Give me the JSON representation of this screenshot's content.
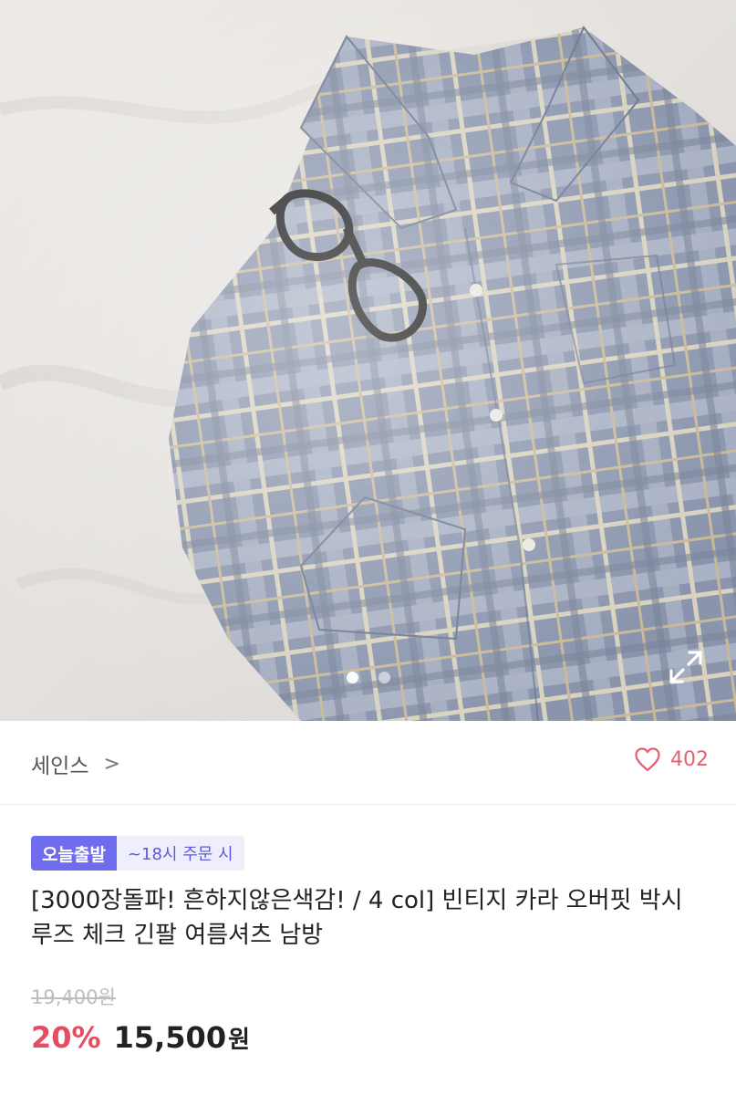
{
  "product_image": {
    "description_icon": "photo-plaid-shirt",
    "carousel_count": 2,
    "carousel_active": 1,
    "expand_icon": "expand-icon"
  },
  "seller": {
    "name": "세인스",
    "chevron": ">"
  },
  "likes": {
    "icon": "heart-icon",
    "count": "402"
  },
  "badges": {
    "main": "오늘출발",
    "sub": "~18시 주문 시"
  },
  "product": {
    "title": "[3000장돌파! 흔하지않은색감! / 4 col] 빈티지 카라 오버핏 박시 루즈 체크 긴팔 여름셔츠 남방",
    "original_price": "19,400원",
    "discount": "20%",
    "price": "15,500",
    "currency": "원"
  },
  "colors": {
    "discount": "#e54d62",
    "badge": "#6f6ded",
    "heart": "#e26173"
  }
}
